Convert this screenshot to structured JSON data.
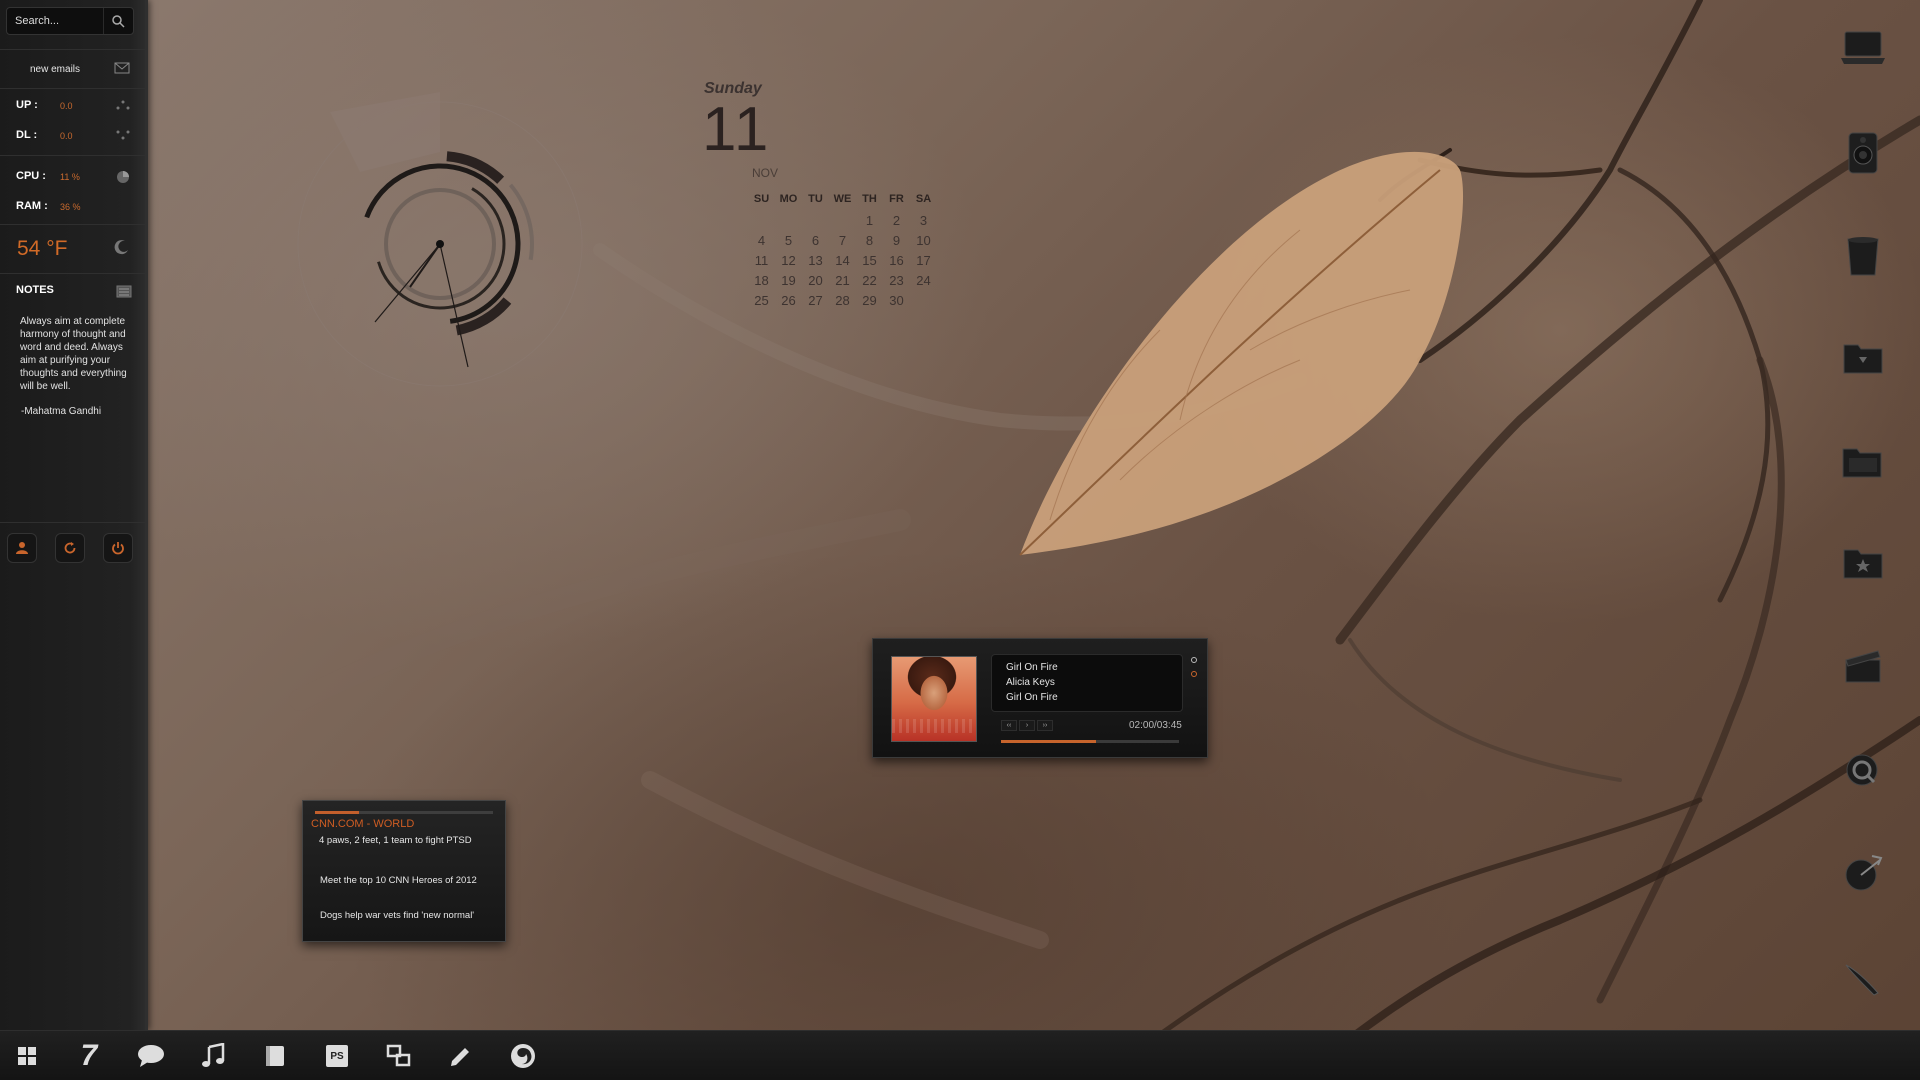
{
  "sidebar": {
    "search": {
      "placeholder": "Search..."
    },
    "emails_label": "new emails",
    "stats": [
      {
        "label": "UP :",
        "value": "0.0"
      },
      {
        "label": "DL :",
        "value": "0.0"
      },
      {
        "label": "CPU :",
        "value": "11 %"
      },
      {
        "label": "RAM :",
        "value": "36 %"
      }
    ],
    "temperature": "54 °F",
    "notes_title": "NOTES",
    "notes_text": "Always aim at complete harmony of thought and word and deed. Always aim at purifying your thoughts and everything will be well.",
    "notes_author": "-Mahatma Gandhi",
    "buttons": [
      "user-icon",
      "refresh-icon",
      "power-icon"
    ]
  },
  "calendar": {
    "day_name": "Sunday",
    "date": "11",
    "month": "NOV",
    "headers": [
      "SU",
      "MO",
      "TU",
      "WE",
      "TH",
      "FR",
      "SA"
    ],
    "days": [
      "",
      "",
      "",
      "",
      "1",
      "2",
      "3",
      "4",
      "5",
      "6",
      "7",
      "8",
      "9",
      "10",
      "11",
      "12",
      "13",
      "14",
      "15",
      "16",
      "17",
      "18",
      "19",
      "20",
      "21",
      "22",
      "23",
      "24",
      "25",
      "26",
      "27",
      "28",
      "29",
      "30",
      ""
    ]
  },
  "player": {
    "line1": "Girl On Fire",
    "line2": "Alicia Keys",
    "line3": "Girl On Fire",
    "time": "02:00/03:45",
    "progress": 0.533,
    "controls": [
      "‹‹",
      "›",
      "››"
    ]
  },
  "news": {
    "title": "CNN.COM - WORLD",
    "items": [
      "4 paws, 2 feet, 1 team to fight PTSD",
      "Meet the top 10 CNN Heroes of 2012",
      "Dogs help war vets find 'new normal'"
    ]
  },
  "right_dock": [
    "laptop-icon",
    "speaker-icon",
    "trash-icon",
    "downloads-folder-icon",
    "open-folder-icon",
    "favorites-folder-icon",
    "movie-clapper-icon",
    "search-app-icon",
    "chart-app-icon",
    "quill-icon"
  ],
  "taskbar": {
    "icons": [
      "start-icon",
      "windows7-icon",
      "chat-icon",
      "music-icon",
      "notebook-icon",
      "photoshop-icon",
      "window-switch-icon",
      "pencil-icon",
      "firefox-icon"
    ],
    "seven_label": "7",
    "ps_label": "PS"
  },
  "colors": {
    "accent": "#c9652c",
    "panel": "#1e1e1e"
  }
}
